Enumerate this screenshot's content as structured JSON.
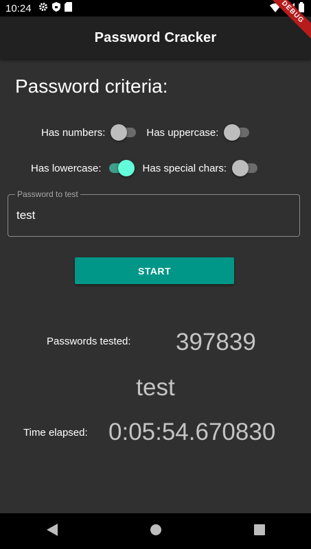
{
  "status_bar": {
    "time": "10:24"
  },
  "app_bar": {
    "title": "Password Cracker",
    "debug_banner": "DEBUG"
  },
  "criteria": {
    "heading": "Password criteria:",
    "has_numbers": {
      "label": "Has numbers:",
      "on": false
    },
    "has_uppercase": {
      "label": "Has uppercase:",
      "on": false
    },
    "has_lowercase": {
      "label": "Has lowercase:",
      "on": true
    },
    "has_special": {
      "label": "Has special chars:",
      "on": false
    }
  },
  "password_field": {
    "label": "Password to test",
    "value": "test"
  },
  "start_button": {
    "label": "START"
  },
  "stats": {
    "tested_label": "Passwords tested:",
    "tested_value": "397839",
    "current_password": "test",
    "elapsed_label": "Time elapsed:",
    "elapsed_value": "0:05:54.670830"
  },
  "colors": {
    "accent": "#009688",
    "switch_on": "#64ffda",
    "background": "#303030",
    "app_bar": "#212121"
  },
  "icons": [
    "gear-icon",
    "shield-icon",
    "sd-card-icon",
    "wifi-icon",
    "signal-icon",
    "battery-icon",
    "back-icon",
    "home-icon",
    "recents-icon"
  ]
}
